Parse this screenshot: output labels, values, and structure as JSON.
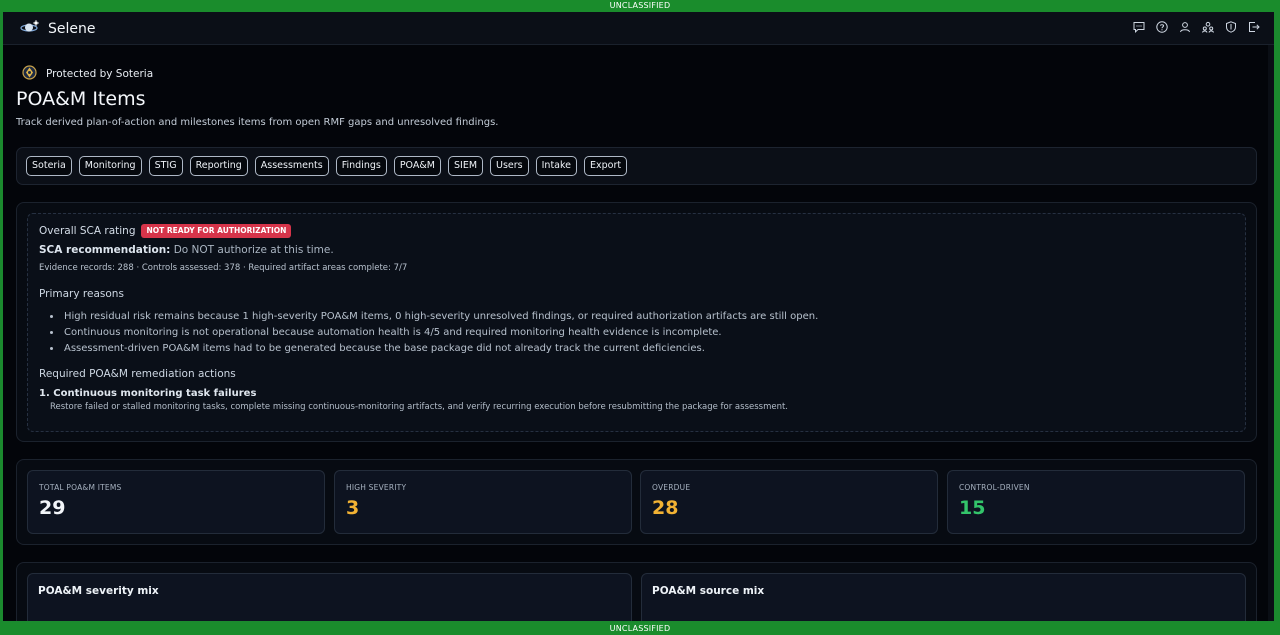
{
  "banner": {
    "top": "UNCLASSIFIED",
    "bottom": "UNCLASSIFIED"
  },
  "app": {
    "title": "Selene",
    "logo_icon": "satellite-planet-icon",
    "actions": [
      {
        "name": "feedback",
        "icon": "chat-icon"
      },
      {
        "name": "help",
        "icon": "help-circle-icon"
      },
      {
        "name": "account",
        "icon": "user-icon"
      },
      {
        "name": "users-admin",
        "icon": "users-icon"
      },
      {
        "name": "security",
        "icon": "shield-icon"
      },
      {
        "name": "logout",
        "icon": "logout-icon"
      }
    ]
  },
  "header": {
    "protected_text": "Protected by Soteria",
    "title": "POA&M Items",
    "subtitle": "Track derived plan-of-action and milestones items from open RMF gaps and unresolved findings."
  },
  "nav": {
    "items": [
      "Soteria",
      "Monitoring",
      "STIG",
      "Reporting",
      "Assessments",
      "Findings",
      "POA&M",
      "SIEM",
      "Users",
      "Intake",
      "Export"
    ]
  },
  "sca": {
    "rating_label": "Overall SCA rating",
    "badge": "NOT READY FOR AUTHORIZATION",
    "badge_color": "#d6344a",
    "recommendation_label": "SCA recommendation:",
    "recommendation_value": " Do NOT authorize at this time.",
    "evidence": "Evidence records: 288 · Controls assessed: 378 · Required artifact areas complete: 7/7",
    "reasons_heading": "Primary reasons",
    "reasons": [
      "High residual risk remains because 1 high-severity POA&M items, 0 high-severity unresolved findings, or required authorization artifacts are still open.",
      "Continuous monitoring is not operational because automation health is 4/5 and required monitoring health evidence is incomplete.",
      "Assessment-driven POA&M items had to be generated because the base package did not already track the current deficiencies."
    ],
    "actions_heading": "Required POA&M remediation actions",
    "actions": [
      {
        "title": "1. Continuous monitoring task failures",
        "description": "Restore failed or stalled monitoring tasks, complete missing continuous-monitoring artifacts, and verify recurring execution before resubmitting the package for assessment."
      }
    ]
  },
  "stats": [
    {
      "label": "TOTAL POA&M ITEMS",
      "value": "29",
      "color": "#f2f5f9"
    },
    {
      "label": "HIGH SEVERITY",
      "value": "3",
      "color": "#f2b233"
    },
    {
      "label": "OVERDUE",
      "value": "28",
      "color": "#f2b233"
    },
    {
      "label": "CONTROL-DRIVEN",
      "value": "15",
      "color": "#33c46a"
    }
  ],
  "charts": {
    "severity_title": "POA&M severity mix",
    "source_title": "POA&M source mix"
  }
}
